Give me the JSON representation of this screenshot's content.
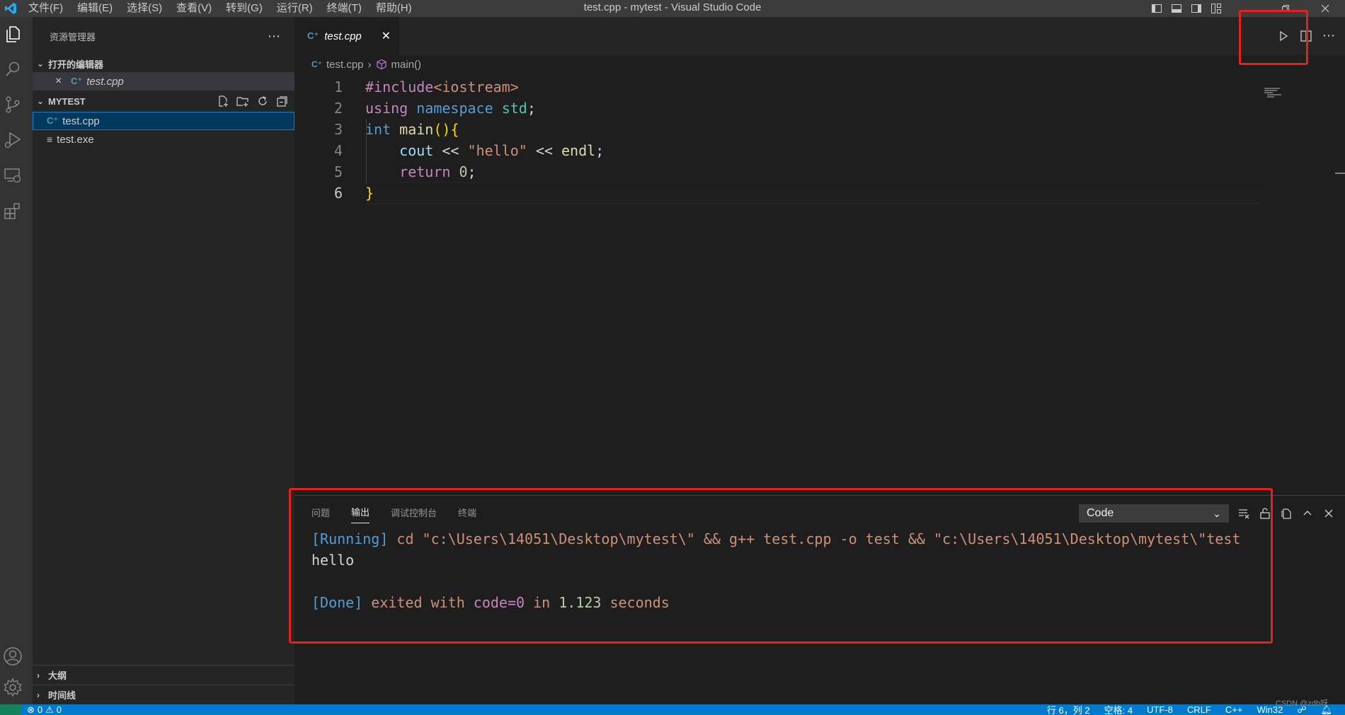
{
  "window": {
    "title": "test.cpp - mytest - Visual Studio Code",
    "menu": [
      "文件(F)",
      "编辑(E)",
      "选择(S)",
      "查看(V)",
      "转到(G)",
      "运行(R)",
      "终端(T)",
      "帮助(H)"
    ]
  },
  "sidebar": {
    "title": "资源管理器",
    "open_editors_label": "打开的编辑器",
    "open_editor_file": "test.cpp",
    "folder_label": "MYTEST",
    "files": [
      "test.cpp",
      "test.exe"
    ],
    "outline_label": "大纲",
    "timeline_label": "时间线"
  },
  "editor": {
    "tab_label": "test.cpp",
    "breadcrumb_file": "test.cpp",
    "breadcrumb_symbol": "main()",
    "line_numbers": [
      "1",
      "2",
      "3",
      "4",
      "5",
      "6"
    ],
    "code": {
      "l1_directive": "#include",
      "l1_header": "<iostream>",
      "l2_using": "using",
      "l2_namespace": "namespace",
      "l2_std": "std",
      "l2_semi": ";",
      "l3_int": "int",
      "l3_main": "main",
      "l3_parens": "()",
      "l3_brace": "{",
      "l4_cout": "cout",
      "l4_op1": " << ",
      "l4_str": "\"hello\"",
      "l4_op2": " << ",
      "l4_endl": "endl",
      "l4_semi": ";",
      "l5_return": "return",
      "l5_zero": "0",
      "l5_semi": ";",
      "l6_brace": "}"
    }
  },
  "panel": {
    "tabs": [
      "问题",
      "输出",
      "调试控制台",
      "终端"
    ],
    "active_tab": "输出",
    "output_channel": "Code",
    "output": {
      "running_tag": "[Running]",
      "running_cmd": " cd \"c:\\Users\\14051\\Desktop\\mytest\\\" && g++ test.cpp -o test && \"c:\\Users\\14051\\Desktop\\mytest\\\"test",
      "hello": "hello",
      "done_tag": "[Done]",
      "done_text1": " exited with ",
      "done_code": "code=0",
      "done_text2": " in ",
      "done_secs": "1.123",
      "done_text3": " seconds"
    }
  },
  "statusbar": {
    "errors": "0",
    "warnings": "0",
    "items": [
      "行 6，列 2",
      "空格: 4",
      "UTF-8",
      "CRLF",
      "C++",
      "Win32"
    ]
  },
  "watermark": "CSDN @zdb呀",
  "colors": {
    "accent": "#007acc",
    "highlight_box": "#e8201c",
    "selection": "#04395e"
  }
}
